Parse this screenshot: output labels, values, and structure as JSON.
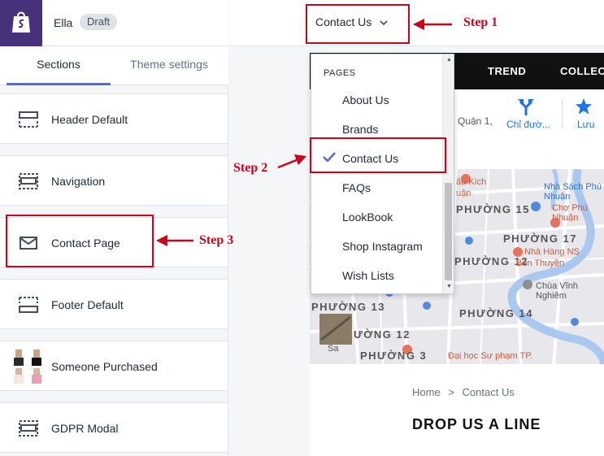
{
  "topbar": {
    "store_name": "Ella",
    "status_badge": "Draft"
  },
  "tabs": {
    "sections": "Sections",
    "theme_settings": "Theme settings"
  },
  "sections": [
    {
      "label": "Header Default",
      "icon": "header-layout-icon"
    },
    {
      "label": "Navigation",
      "icon": "navigation-layout-icon"
    },
    {
      "label": "Contact Page",
      "icon": "envelope-icon"
    },
    {
      "label": "Footer Default",
      "icon": "footer-layout-icon"
    },
    {
      "label": "Someone Purchased",
      "icon": "product-thumbnails"
    },
    {
      "label": "GDPR Modal",
      "icon": "modal-layout-icon"
    }
  ],
  "page_selector": {
    "value": "Contact Us"
  },
  "dropdown": {
    "header": "PAGES",
    "items": [
      "About Us",
      "Brands",
      "Contact Us",
      "FAQs",
      "LookBook",
      "Shop Instagram",
      "Wish Lists"
    ],
    "selected": "Contact Us"
  },
  "preview": {
    "nav": [
      "TREND",
      "COLLEC"
    ],
    "map_bar": {
      "district": "Quận 1,",
      "directions": "Chỉ đườ...",
      "save": "Lưu"
    },
    "map_labels": [
      "PHƯỜNG 15",
      "PHƯỜNG 17",
      "PHƯỜNG 12",
      "PHƯỜNG 14",
      "PHƯỜNG 13",
      "ƯỜNG 12",
      "PHƯỜNG 3"
    ],
    "pois": [
      "ấu Kích",
      "uận",
      "Nhà Sách Phú Nhuận",
      "Chợ Phú Nhuận",
      "Nhà Hàng NS",
      "Bến Thuyền",
      "Chùa Vĩnh Nghiêm",
      "Đại học Sư phạm TP.",
      "Sa"
    ],
    "breadcrumb": {
      "home": "Home",
      "separator": ">",
      "current": "Contact Us"
    },
    "heading": "DROP US A LINE"
  },
  "annotations": {
    "step1": "Step 1",
    "step2": "Step 2",
    "step3": "Step 3"
  },
  "colors": {
    "accent": "#5c6ac4",
    "logo_bg": "#47317a",
    "annotation": "#d0021b",
    "check": "#5c6ac4"
  }
}
